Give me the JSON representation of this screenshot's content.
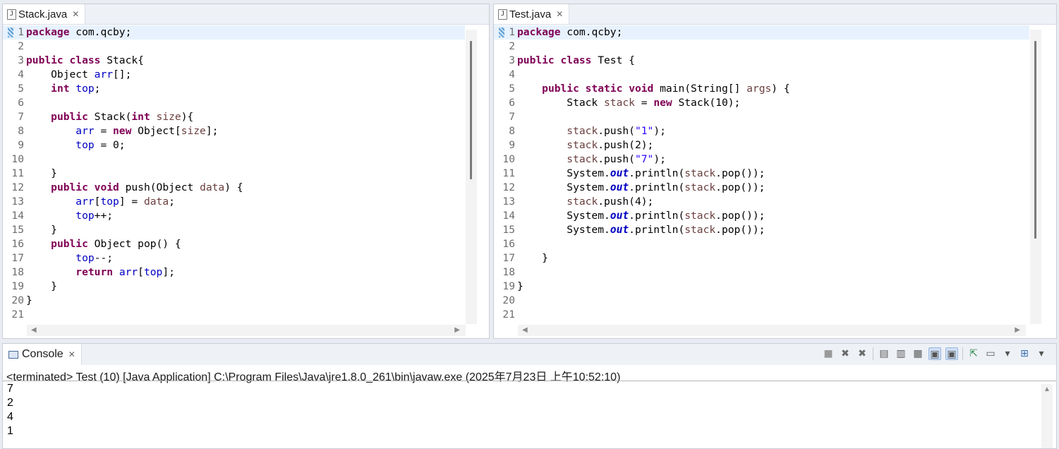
{
  "editors": [
    {
      "tab": "Stack.java",
      "lines": [
        [
          {
            "t": "package",
            "c": "kw"
          },
          {
            "t": " com.qcby;"
          }
        ],
        [],
        [
          {
            "t": "public",
            "c": "kw"
          },
          {
            "t": " "
          },
          {
            "t": "class",
            "c": "kw"
          },
          {
            "t": " Stack{"
          }
        ],
        [
          {
            "t": "    Object "
          },
          {
            "t": "arr",
            "c": "fld"
          },
          {
            "t": "[];"
          }
        ],
        [
          {
            "t": "    "
          },
          {
            "t": "int",
            "c": "kw"
          },
          {
            "t": " "
          },
          {
            "t": "top",
            "c": "fld"
          },
          {
            "t": ";"
          }
        ],
        [],
        [
          {
            "t": "    "
          },
          {
            "t": "public",
            "c": "kw"
          },
          {
            "t": " Stack("
          },
          {
            "t": "int",
            "c": "kw"
          },
          {
            "t": " "
          },
          {
            "t": "size",
            "c": "var"
          },
          {
            "t": "){"
          }
        ],
        [
          {
            "t": "        "
          },
          {
            "t": "arr",
            "c": "fld"
          },
          {
            "t": " = "
          },
          {
            "t": "new",
            "c": "kw"
          },
          {
            "t": " Object["
          },
          {
            "t": "size",
            "c": "var"
          },
          {
            "t": "];"
          }
        ],
        [
          {
            "t": "        "
          },
          {
            "t": "top",
            "c": "fld"
          },
          {
            "t": " = 0;"
          }
        ],
        [],
        [
          {
            "t": "    }"
          }
        ],
        [
          {
            "t": "    "
          },
          {
            "t": "public",
            "c": "kw"
          },
          {
            "t": " "
          },
          {
            "t": "void",
            "c": "kw"
          },
          {
            "t": " push(Object "
          },
          {
            "t": "data",
            "c": "var"
          },
          {
            "t": ") {"
          }
        ],
        [
          {
            "t": "        "
          },
          {
            "t": "arr",
            "c": "fld"
          },
          {
            "t": "["
          },
          {
            "t": "top",
            "c": "fld"
          },
          {
            "t": "] = "
          },
          {
            "t": "data",
            "c": "var"
          },
          {
            "t": ";"
          }
        ],
        [
          {
            "t": "        "
          },
          {
            "t": "top",
            "c": "fld"
          },
          {
            "t": "++;"
          }
        ],
        [
          {
            "t": "    }"
          }
        ],
        [
          {
            "t": "    "
          },
          {
            "t": "public",
            "c": "kw"
          },
          {
            "t": " Object pop() {"
          }
        ],
        [
          {
            "t": "        "
          },
          {
            "t": "top",
            "c": "fld"
          },
          {
            "t": "--;"
          }
        ],
        [
          {
            "t": "        "
          },
          {
            "t": "return",
            "c": "kw"
          },
          {
            "t": " "
          },
          {
            "t": "arr",
            "c": "fld"
          },
          {
            "t": "["
          },
          {
            "t": "top",
            "c": "fld"
          },
          {
            "t": "];"
          }
        ],
        [
          {
            "t": "    }"
          }
        ],
        [
          {
            "t": "}"
          }
        ],
        []
      ]
    },
    {
      "tab": "Test.java",
      "lines": [
        [
          {
            "t": "package",
            "c": "kw"
          },
          {
            "t": " com.qcby;"
          }
        ],
        [],
        [
          {
            "t": "public",
            "c": "kw"
          },
          {
            "t": " "
          },
          {
            "t": "class",
            "c": "kw"
          },
          {
            "t": " Test {"
          }
        ],
        [],
        [
          {
            "t": "    "
          },
          {
            "t": "public",
            "c": "kw"
          },
          {
            "t": " "
          },
          {
            "t": "static",
            "c": "kw"
          },
          {
            "t": " "
          },
          {
            "t": "void",
            "c": "kw"
          },
          {
            "t": " main(String[] "
          },
          {
            "t": "args",
            "c": "var"
          },
          {
            "t": ") {"
          }
        ],
        [
          {
            "t": "        Stack "
          },
          {
            "t": "stack",
            "c": "var"
          },
          {
            "t": " = "
          },
          {
            "t": "new",
            "c": "kw"
          },
          {
            "t": " Stack(10);"
          }
        ],
        [],
        [
          {
            "t": "        "
          },
          {
            "t": "stack",
            "c": "var"
          },
          {
            "t": ".push("
          },
          {
            "t": "\"1\"",
            "c": "str"
          },
          {
            "t": ");"
          }
        ],
        [
          {
            "t": "        "
          },
          {
            "t": "stack",
            "c": "var"
          },
          {
            "t": ".push(2);"
          }
        ],
        [
          {
            "t": "        "
          },
          {
            "t": "stack",
            "c": "var"
          },
          {
            "t": ".push("
          },
          {
            "t": "\"7\"",
            "c": "str"
          },
          {
            "t": ");"
          }
        ],
        [
          {
            "t": "        System."
          },
          {
            "t": "out",
            "c": "sfld"
          },
          {
            "t": ".println("
          },
          {
            "t": "stack",
            "c": "var"
          },
          {
            "t": ".pop());"
          }
        ],
        [
          {
            "t": "        System."
          },
          {
            "t": "out",
            "c": "sfld"
          },
          {
            "t": ".println("
          },
          {
            "t": "stack",
            "c": "var"
          },
          {
            "t": ".pop());"
          }
        ],
        [
          {
            "t": "        "
          },
          {
            "t": "stack",
            "c": "var"
          },
          {
            "t": ".push(4);"
          }
        ],
        [
          {
            "t": "        System."
          },
          {
            "t": "out",
            "c": "sfld"
          },
          {
            "t": ".println("
          },
          {
            "t": "stack",
            "c": "var"
          },
          {
            "t": ".pop());"
          }
        ],
        [
          {
            "t": "        System."
          },
          {
            "t": "out",
            "c": "sfld"
          },
          {
            "t": ".println("
          },
          {
            "t": "stack",
            "c": "var"
          },
          {
            "t": ".pop());"
          }
        ],
        [],
        [
          {
            "t": "    }"
          }
        ],
        [],
        [
          {
            "t": "}"
          }
        ],
        [],
        []
      ]
    }
  ],
  "console": {
    "tab": "Console",
    "header": "<terminated> Test (10) [Java Application] C:\\Program Files\\Java\\jre1.8.0_261\\bin\\javaw.exe (2025年7月23日 上午10:52:10)",
    "output": [
      "7",
      "2",
      "4",
      "1"
    ],
    "toolbar": [
      {
        "icon": "terminate-icon",
        "glyph": "■"
      },
      {
        "icon": "remove-launch-icon",
        "glyph": "✖"
      },
      {
        "icon": "remove-all-terminated-icon",
        "glyph": "✖"
      },
      {
        "sep": true
      },
      {
        "icon": "clear-console-icon",
        "glyph": "▤"
      },
      {
        "icon": "scroll-lock-icon",
        "glyph": "▥"
      },
      {
        "icon": "word-wrap-icon",
        "glyph": "▦"
      },
      {
        "icon": "show-console-on-output-icon",
        "glyph": "▣",
        "pressed": true
      },
      {
        "icon": "show-console-on-error-icon",
        "glyph": "▣",
        "pressed": true
      },
      {
        "sep": true
      },
      {
        "icon": "pin-console-icon",
        "glyph": "⇱"
      },
      {
        "icon": "display-selected-console-icon",
        "glyph": "▭"
      },
      {
        "icon": "display-dropdown-icon",
        "glyph": "▾"
      },
      {
        "icon": "open-console-icon",
        "glyph": "⊞"
      },
      {
        "icon": "open-console-dropdown-icon",
        "glyph": "▾"
      }
    ]
  }
}
